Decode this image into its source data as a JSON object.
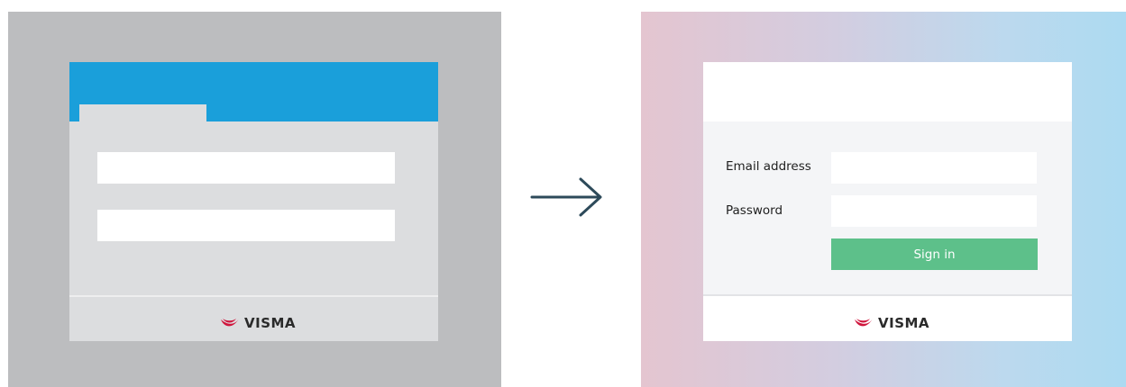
{
  "old_design": {
    "logo_text": "VISMA"
  },
  "arrow": {
    "icon": "arrow-right-icon",
    "color": "#2d4a5a"
  },
  "new_design": {
    "email_label": "Email address",
    "email_value": "",
    "password_label": "Password",
    "password_value": "",
    "signin_label": "Sign in",
    "logo_text": "VISMA"
  },
  "colors": {
    "old_header": "#1a9fda",
    "signin_button": "#5dc08a",
    "logo_red": "#d0163d"
  }
}
